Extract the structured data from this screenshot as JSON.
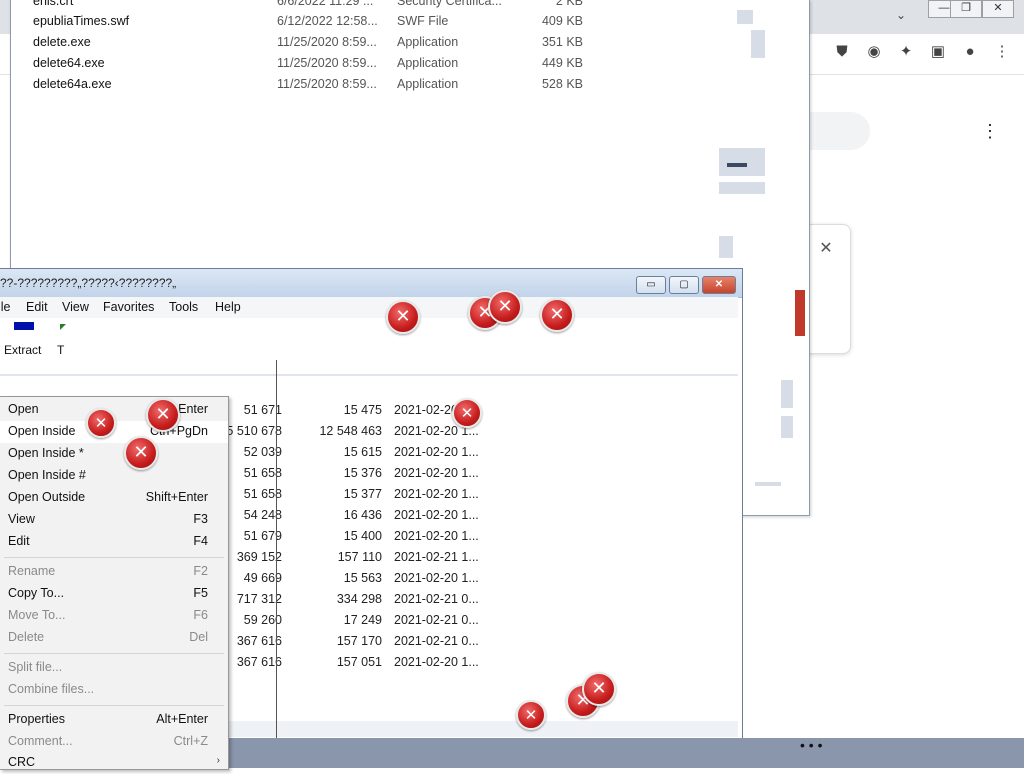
{
  "explorer": {
    "files": [
      {
        "name": "enis.crt",
        "date": "6/6/2022 11:29 ...",
        "type": "Security Certifica...",
        "size": "2 KB"
      },
      {
        "name": "epubliaTimes.swf",
        "date": "6/12/2022 12:58...",
        "type": "SWF File",
        "size": "409 KB"
      },
      {
        "name": "delete.exe",
        "date": "11/25/2020 8:59...",
        "type": "Application",
        "size": "351 KB"
      },
      {
        "name": "delete64.exe",
        "date": "11/25/2020 8:59...",
        "type": "Application",
        "size": "449 KB"
      },
      {
        "name": "delete64a.exe",
        "date": "11/25/2020 8:59...",
        "type": "Application",
        "size": "528 KB"
      }
    ]
  },
  "chrome": {
    "minimize": "—",
    "restore": "❐",
    "close": "✕",
    "extensions": [
      "ublock-icon",
      "translate-icon",
      "puzzle-icon",
      "sidepanel-icon",
      "profile-icon",
      "kebab-icon"
    ],
    "kebab": "⋮",
    "card_close": "✕"
  },
  "zip": {
    "title": "??-?????????„?????‹????????„",
    "minimize": "▭",
    "maximize": "▢",
    "close": "✕",
    "menu": [
      "ile",
      "Edit",
      "View",
      "Favorites",
      "Tools",
      "Help"
    ],
    "toolbar": {
      "extract": "Extract",
      "test": "T"
    },
    "rows": [
      {
        "size": "51 671",
        "packed": "15 475",
        "modified": "2021-02-20 1..."
      },
      {
        "size": "5 510 678",
        "packed": "12 548 463",
        "modified": "2021-02-20 1..."
      },
      {
        "size": "52 039",
        "packed": "15 615",
        "modified": "2021-02-20 1..."
      },
      {
        "size": "51 658",
        "packed": "15 376",
        "modified": "2021-02-20 1..."
      },
      {
        "size": "51 658",
        "packed": "15 377",
        "modified": "2021-02-20 1..."
      },
      {
        "size": "54 248",
        "packed": "16 436",
        "modified": "2021-02-20 1..."
      },
      {
        "size": "51 679",
        "packed": "15 400",
        "modified": "2021-02-20 1..."
      },
      {
        "size": "369 152",
        "packed": "157 110",
        "modified": "2021-02-21 1..."
      },
      {
        "size": "49 669",
        "packed": "15 563",
        "modified": "2021-02-20 1..."
      },
      {
        "size": "717 312",
        "packed": "334 298",
        "modified": "2021-02-21 0..."
      },
      {
        "size": "59 260",
        "packed": "17 249",
        "modified": "2021-02-21 0..."
      },
      {
        "size": "367 616",
        "packed": "157 170",
        "modified": "2021-02-21 0..."
      },
      {
        "size": "367 616",
        "packed": "157 051",
        "modified": "2021-02-20 1..."
      }
    ]
  },
  "context_menu": {
    "items": [
      {
        "label": "Open",
        "shortcut": "Enter",
        "enabled": true
      },
      {
        "label": "Open Inside",
        "shortcut": "Ctrl+PgDn",
        "enabled": true
      },
      {
        "label": "Open Inside *",
        "shortcut": "",
        "enabled": true
      },
      {
        "label": "Open Inside #",
        "shortcut": "",
        "enabled": true
      },
      {
        "label": "Open Outside",
        "shortcut": "Shift+Enter",
        "enabled": true
      },
      {
        "label": "View",
        "shortcut": "F3",
        "enabled": true
      },
      {
        "label": "Edit",
        "shortcut": "F4",
        "enabled": true
      },
      {
        "label": "Rename",
        "shortcut": "F2",
        "enabled": false
      },
      {
        "label": "Copy To...",
        "shortcut": "F5",
        "enabled": true
      },
      {
        "label": "Move To...",
        "shortcut": "F6",
        "enabled": false
      },
      {
        "label": "Delete",
        "shortcut": "Del",
        "enabled": false
      },
      {
        "label": "Split file...",
        "shortcut": "",
        "enabled": false
      },
      {
        "label": "Combine files...",
        "shortcut": "",
        "enabled": false
      },
      {
        "label": "Properties",
        "shortcut": "Alt+Enter",
        "enabled": true
      },
      {
        "label": "Comment...",
        "shortcut": "Ctrl+Z",
        "enabled": false
      },
      {
        "label": "CRC",
        "shortcut": "",
        "enabled": true
      }
    ],
    "submenu_arrow": "›"
  },
  "error_icon_glyph": "✕",
  "taskbar_dots": "• • •"
}
